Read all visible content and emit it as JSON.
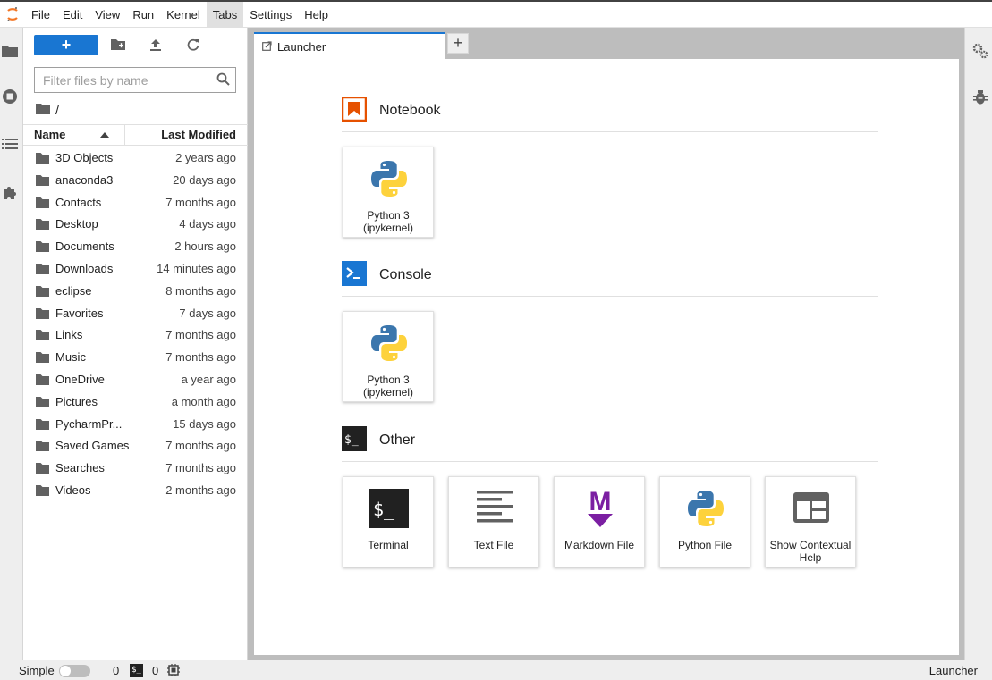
{
  "menubar": {
    "items": [
      "File",
      "Edit",
      "View",
      "Run",
      "Kernel",
      "Tabs",
      "Settings",
      "Help"
    ],
    "active_index": 5
  },
  "leftbar": {
    "icons": [
      "folder-icon",
      "running-icon",
      "toc-icon",
      "extension-icon"
    ]
  },
  "filebrowser": {
    "new_label": "+",
    "filter_placeholder": "Filter files by name",
    "breadcrumb": "/",
    "columns": {
      "name": "Name",
      "modified": "Last Modified"
    },
    "files": [
      {
        "name": "3D Objects",
        "modified": "2 years ago"
      },
      {
        "name": "anaconda3",
        "modified": "20 days ago"
      },
      {
        "name": "Contacts",
        "modified": "7 months ago"
      },
      {
        "name": "Desktop",
        "modified": "4 days ago"
      },
      {
        "name": "Documents",
        "modified": "2 hours ago"
      },
      {
        "name": "Downloads",
        "modified": "14 minutes ago"
      },
      {
        "name": "eclipse",
        "modified": "8 months ago"
      },
      {
        "name": "Favorites",
        "modified": "7 days ago"
      },
      {
        "name": "Links",
        "modified": "7 months ago"
      },
      {
        "name": "Music",
        "modified": "7 months ago"
      },
      {
        "name": "OneDrive",
        "modified": "a year ago"
      },
      {
        "name": "Pictures",
        "modified": "a month ago"
      },
      {
        "name": "PycharmPr...",
        "modified": "15 days ago"
      },
      {
        "name": "Saved Games",
        "modified": "7 months ago"
      },
      {
        "name": "Searches",
        "modified": "7 months ago"
      },
      {
        "name": "Videos",
        "modified": "2 months ago"
      }
    ]
  },
  "tabs": {
    "active": "Launcher",
    "add": "+"
  },
  "launcher": {
    "sections": [
      {
        "title": "Notebook",
        "cards": [
          {
            "label1": "Python 3",
            "label2": "(ipykernel)"
          }
        ]
      },
      {
        "title": "Console",
        "cards": [
          {
            "label1": "Python 3",
            "label2": "(ipykernel)"
          }
        ]
      },
      {
        "title": "Other",
        "cards": [
          {
            "label1": "Terminal",
            "label2": ""
          },
          {
            "label1": "Text File",
            "label2": ""
          },
          {
            "label1": "Markdown File",
            "label2": ""
          },
          {
            "label1": "Python File",
            "label2": ""
          },
          {
            "label1": "Show Contextual",
            "label2": "Help"
          }
        ]
      }
    ]
  },
  "statusbar": {
    "simple_label": "Simple",
    "simple_mode_on": false,
    "terminals_count": "0",
    "kernels_count": "0",
    "terminal_icon_text": "$_",
    "mode": "Launcher"
  },
  "colors": {
    "accent": "#1976d2",
    "notebook_icon": "#e65100",
    "console_icon": "#1976d2",
    "markdown": "#7b1fa2",
    "python_blue": "#3b76ad",
    "python_yellow": "#fdd23c"
  }
}
